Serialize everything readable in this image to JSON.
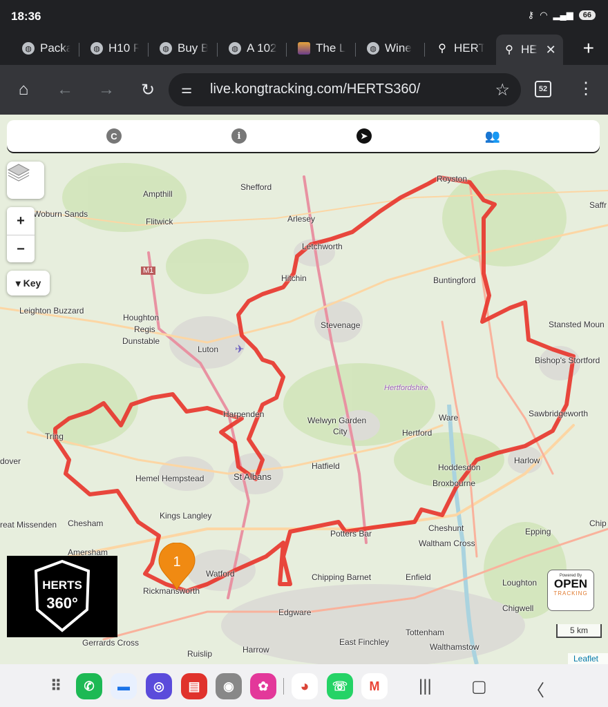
{
  "status": {
    "time": "18:36",
    "battery": "66"
  },
  "tabs": [
    {
      "title": "Packa",
      "favicon": "globe-icon"
    },
    {
      "title": "H10 R",
      "favicon": "globe-icon"
    },
    {
      "title": "Buy B",
      "favicon": "globe-icon"
    },
    {
      "title": "A 102",
      "favicon": "globe-icon"
    },
    {
      "title": "The L",
      "favicon": "site-image-icon"
    },
    {
      "title": "Wine",
      "favicon": "globe-icon"
    },
    {
      "title": "HERT",
      "favicon": "map-pin-icon"
    },
    {
      "title": "HE",
      "favicon": "map-pin-icon",
      "active": true
    }
  ],
  "toolbar": {
    "url": "live.kongtracking.com/HERTS360/",
    "tab_count": "52"
  },
  "map": {
    "top_controls": [
      "c-icon",
      "info-icon",
      "navigate-icon",
      "people-icon"
    ],
    "zoom_in": "+",
    "zoom_out": "−",
    "key_label": "▾ Key",
    "marker_number": "1",
    "scale": "5 km",
    "attribution": "Leaflet",
    "logo_line1": "HERTS",
    "logo_line2": "360°",
    "open_tracking": {
      "powered": "Powered By",
      "open": "OPEN",
      "tracking": "TRACKING"
    },
    "route_color": "#e8332a",
    "marker_color": "#f08a12",
    "places": {
      "royston": "Royston",
      "shefford": "Shefford",
      "ampthill": "Ampthill",
      "woburn": "Woburn Sands",
      "flitwick": "Flitwick",
      "arlesey": "Arlesey",
      "letchworth": "Letchworth",
      "hitchin": "Hitchin",
      "buntingford": "Buntingford",
      "saffr": "Saffr",
      "m1": "M1",
      "leighton": "Leighton Buzzard",
      "houghton": "Houghton",
      "regis": "Regis",
      "dunstable": "Dunstable",
      "stevenage": "Stevenage",
      "stansted": "Stansted Moun",
      "luton": "Luton",
      "bishops": "Bishop's Stortford",
      "hertfordshire": "Hertfordshire",
      "harpenden": "Harpenden",
      "welwyn1": "Welwyn Garden",
      "welwyn2": "City",
      "ware": "Ware",
      "sawbridge": "Sawbridgeworth",
      "tring": "Tring",
      "hertford": "Hertford",
      "dover": "dover",
      "hoddesdon": "Hoddesdon",
      "harlow": "Harlow",
      "hatfield": "Hatfield",
      "hemel": "Hemel Hempstead",
      "stalbans": "St Albans",
      "broxbourne": "Broxbourne",
      "kings": "Kings Langley",
      "missenden": "reat Missenden",
      "chesham": "Chesham",
      "pottersbar": "Potters Bar",
      "cheshunt": "Cheshunt",
      "epping": "Epping",
      "chip": "Chip",
      "waltham": "Waltham Cross",
      "amersham": "Amersham",
      "watford": "Watford",
      "chipping": "Chipping Barnet",
      "enfield": "Enfield",
      "loughton": "Loughton",
      "rickmansworth": "Rickmansworth",
      "edgware": "Edgware",
      "chigwell": "Chigwell",
      "tottenham": "Tottenham",
      "gerrards": "Gerrards Cross",
      "finchley": "East Finchley",
      "walthamstow": "Walthamstow",
      "harrow": "Harrow",
      "ruislip": "Ruislip"
    }
  },
  "dock": {
    "apps": [
      "apps-grid-icon",
      "phone-icon",
      "messages-icon",
      "internet-icon",
      "notes-icon",
      "camera-icon",
      "gallery-icon",
      "chrome-icon",
      "whatsapp-icon",
      "gmail-icon"
    ],
    "nav": [
      "recents-icon",
      "home-icon",
      "back-icon"
    ]
  }
}
